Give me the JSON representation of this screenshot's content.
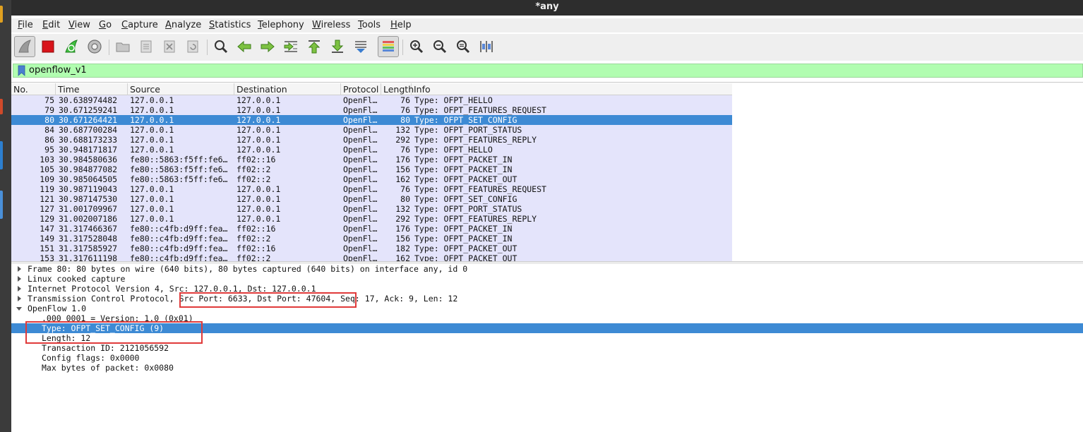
{
  "window": {
    "title": "*any"
  },
  "menu": [
    "File",
    "Edit",
    "View",
    "Go",
    "Capture",
    "Analyze",
    "Statistics",
    "Telephony",
    "Wireless",
    "Tools",
    "Help"
  ],
  "toolbar": {
    "buttons": [
      "shark-fin-start-icon",
      "stop-capture-icon",
      "restart-capture-icon",
      "capture-options-icon",
      "open-file-icon",
      "save-file-icon",
      "close-file-icon",
      "reload-file-icon",
      "find-packet-icon",
      "go-back-icon",
      "go-forward-icon",
      "go-to-packet-icon",
      "go-first-packet-icon",
      "go-last-packet-icon",
      "autoscroll-icon",
      "colorize-icon",
      "zoom-in-icon",
      "zoom-out-icon",
      "normal-size-icon",
      "resize-columns-icon"
    ]
  },
  "filter": {
    "value": "openflow_v1"
  },
  "packet_list": {
    "columns": [
      "No.",
      "Time",
      "Source",
      "Destination",
      "Protocol",
      "Length",
      "Info"
    ],
    "selected_index": 2,
    "rows": [
      [
        "75",
        "30.638974482",
        "127.0.0.1",
        "127.0.0.1",
        "OpenFl…",
        "76",
        "Type: OFPT_HELLO"
      ],
      [
        "79",
        "30.671259241",
        "127.0.0.1",
        "127.0.0.1",
        "OpenFl…",
        "76",
        "Type: OFPT_FEATURES_REQUEST"
      ],
      [
        "80",
        "30.671264421",
        "127.0.0.1",
        "127.0.0.1",
        "OpenFl…",
        "80",
        "Type: OFPT_SET_CONFIG"
      ],
      [
        "84",
        "30.687700284",
        "127.0.0.1",
        "127.0.0.1",
        "OpenFl…",
        "132",
        "Type: OFPT_PORT_STATUS"
      ],
      [
        "86",
        "30.688173233",
        "127.0.0.1",
        "127.0.0.1",
        "OpenFl…",
        "292",
        "Type: OFPT_FEATURES_REPLY"
      ],
      [
        "95",
        "30.948171817",
        "127.0.0.1",
        "127.0.0.1",
        "OpenFl…",
        "76",
        "Type: OFPT_HELLO"
      ],
      [
        "103",
        "30.984580636",
        "fe80::5863:f5ff:fe6…",
        "ff02::16",
        "OpenFl…",
        "176",
        "Type: OFPT_PACKET_IN"
      ],
      [
        "105",
        "30.984877082",
        "fe80::5863:f5ff:fe6…",
        "ff02::2",
        "OpenFl…",
        "156",
        "Type: OFPT_PACKET_IN"
      ],
      [
        "109",
        "30.985064505",
        "fe80::5863:f5ff:fe6…",
        "ff02::2",
        "OpenFl…",
        "162",
        "Type: OFPT_PACKET_OUT"
      ],
      [
        "119",
        "30.987119043",
        "127.0.0.1",
        "127.0.0.1",
        "OpenFl…",
        "76",
        "Type: OFPT_FEATURES_REQUEST"
      ],
      [
        "121",
        "30.987147530",
        "127.0.0.1",
        "127.0.0.1",
        "OpenFl…",
        "80",
        "Type: OFPT_SET_CONFIG"
      ],
      [
        "127",
        "31.001709967",
        "127.0.0.1",
        "127.0.0.1",
        "OpenFl…",
        "132",
        "Type: OFPT_PORT_STATUS"
      ],
      [
        "129",
        "31.002007186",
        "127.0.0.1",
        "127.0.0.1",
        "OpenFl…",
        "292",
        "Type: OFPT_FEATURES_REPLY"
      ],
      [
        "147",
        "31.317466367",
        "fe80::c4fb:d9ff:fea…",
        "ff02::16",
        "OpenFl…",
        "176",
        "Type: OFPT_PACKET_IN"
      ],
      [
        "149",
        "31.317528048",
        "fe80::c4fb:d9ff:fea…",
        "ff02::2",
        "OpenFl…",
        "156",
        "Type: OFPT_PACKET_IN"
      ],
      [
        "151",
        "31.317585927",
        "fe80::c4fb:d9ff:fea…",
        "ff02::16",
        "OpenFl…",
        "182",
        "Type: OFPT_PACKET_OUT"
      ],
      [
        "153",
        "31.317611198",
        "fe80::c4fb:d9ff:fea…",
        "ff02::2",
        "OpenFl…",
        "162",
        "Type: OFPT_PACKET_OUT"
      ]
    ]
  },
  "packet_detail": {
    "rows": [
      {
        "text": "Frame 80: 80 bytes on wire (640 bits), 80 bytes captured (640 bits) on interface any, id 0",
        "level": 0,
        "expander": "collapsed"
      },
      {
        "text": "Linux cooked capture",
        "level": 0,
        "expander": "collapsed"
      },
      {
        "text": "Internet Protocol Version 4, Src: 127.0.0.1, Dst: 127.0.0.1",
        "level": 0,
        "expander": "collapsed"
      },
      {
        "text": "Transmission Control Protocol, Src Port: 6633, Dst Port: 47604, Seq: 17, Ack: 9, Len: 12",
        "level": 0,
        "expander": "collapsed"
      },
      {
        "text": "OpenFlow 1.0",
        "level": 0,
        "expander": "expanded"
      },
      {
        "text": ".000 0001 = Version: 1.0 (0x01)",
        "level": 1,
        "expander": "none"
      },
      {
        "text": "Type: OFPT_SET_CONFIG (9)",
        "level": 1,
        "expander": "none",
        "selected": true
      },
      {
        "text": "Length: 12",
        "level": 1,
        "expander": "none"
      },
      {
        "text": "Transaction ID: 2121056592",
        "level": 1,
        "expander": "none"
      },
      {
        "text": "Config flags: 0x0000",
        "level": 1,
        "expander": "none"
      },
      {
        "text": "Max bytes of packet: 0x0080",
        "level": 1,
        "expander": "none"
      }
    ]
  },
  "colors": {
    "row_bg": "#e4e4fb",
    "selection": "#3d8ad4",
    "filter_bg": "#b1fdb0",
    "annotation": "#e03a3a"
  }
}
